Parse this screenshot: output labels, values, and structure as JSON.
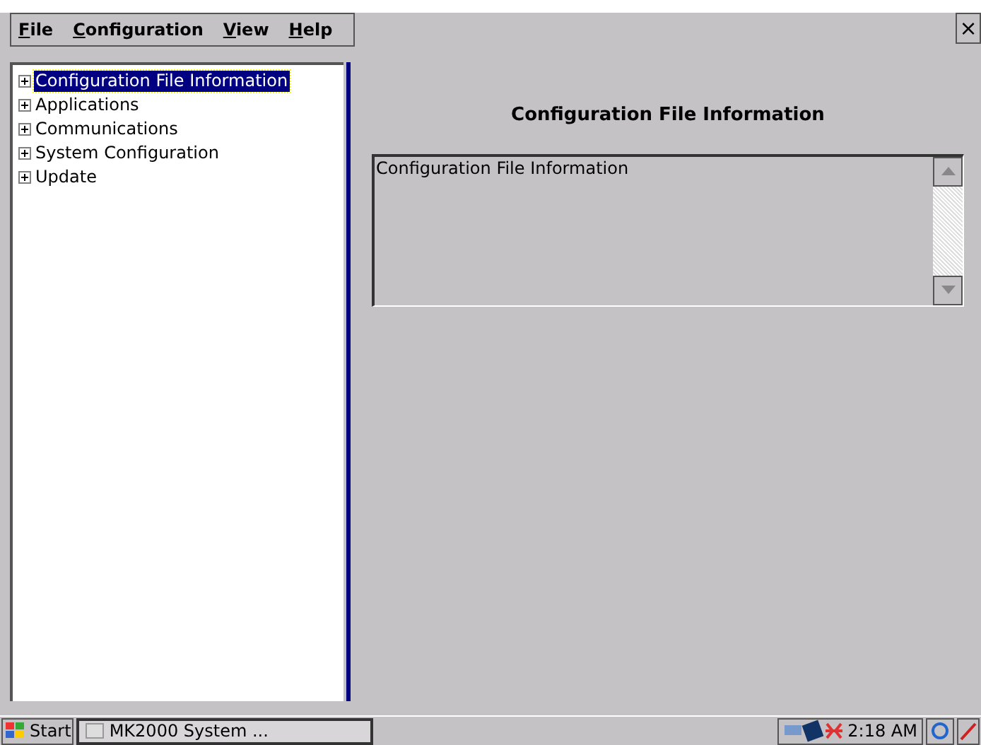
{
  "menu": [
    {
      "label": "File"
    },
    {
      "label": "Configuration"
    },
    {
      "label": "View"
    },
    {
      "label": "Help"
    }
  ],
  "close": "×",
  "tree": [
    {
      "label": "Configuration File Information",
      "selected": true,
      "expanded": false
    },
    {
      "label": "Applications",
      "selected": false,
      "expanded": false
    },
    {
      "label": "Communications",
      "selected": false,
      "expanded": false
    },
    {
      "label": "System Configuration",
      "selected": false,
      "expanded": false
    },
    {
      "label": "Update",
      "selected": false,
      "expanded": false
    }
  ],
  "detail": {
    "title": "Configuration File Information",
    "text": "Configuration File Information"
  },
  "taskbar": {
    "start": "Start",
    "task": "MK2000 System ...",
    "time": "2:18 AM"
  }
}
